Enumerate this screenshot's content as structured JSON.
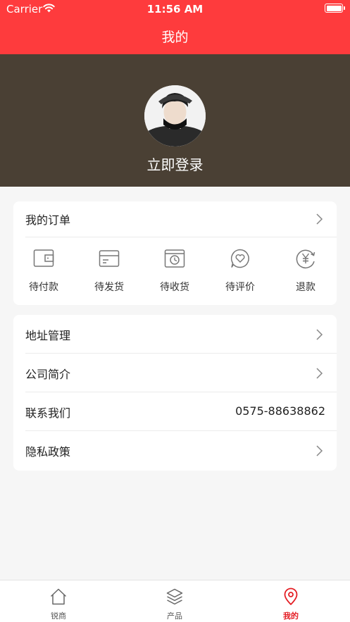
{
  "status_bar": {
    "carrier": "Carrier",
    "time": "11:56 AM",
    "wifi_icon": "wifi-icon",
    "battery_icon": "battery-icon"
  },
  "nav": {
    "title": "我的",
    "background": "#fe3b3d"
  },
  "profile": {
    "avatar_icon": "avatar-photo",
    "login_label": "立即登录",
    "background": "#4a4034"
  },
  "orders": {
    "title": "我的订单",
    "items": [
      {
        "label": "待付款",
        "icon": "wallet-icon"
      },
      {
        "label": "待发货",
        "icon": "card-icon"
      },
      {
        "label": "待收货",
        "icon": "package-clock-icon"
      },
      {
        "label": "待评价",
        "icon": "heart-chat-icon"
      },
      {
        "label": "退款",
        "icon": "yen-refund-icon"
      }
    ]
  },
  "menu": [
    {
      "label": "地址管理",
      "value": null
    },
    {
      "label": "公司简介",
      "value": null
    },
    {
      "label": "联系我们",
      "value": "0575-88638862"
    },
    {
      "label": "隐私政策",
      "value": null
    }
  ],
  "tabs": [
    {
      "label": "锐商",
      "icon": "home-icon",
      "active": false
    },
    {
      "label": "产品",
      "icon": "layers-icon",
      "active": false
    },
    {
      "label": "我的",
      "icon": "location-pin-icon",
      "active": true
    }
  ],
  "colors": {
    "accent": "#fe3b3d",
    "active_tab": "#e41d23"
  }
}
